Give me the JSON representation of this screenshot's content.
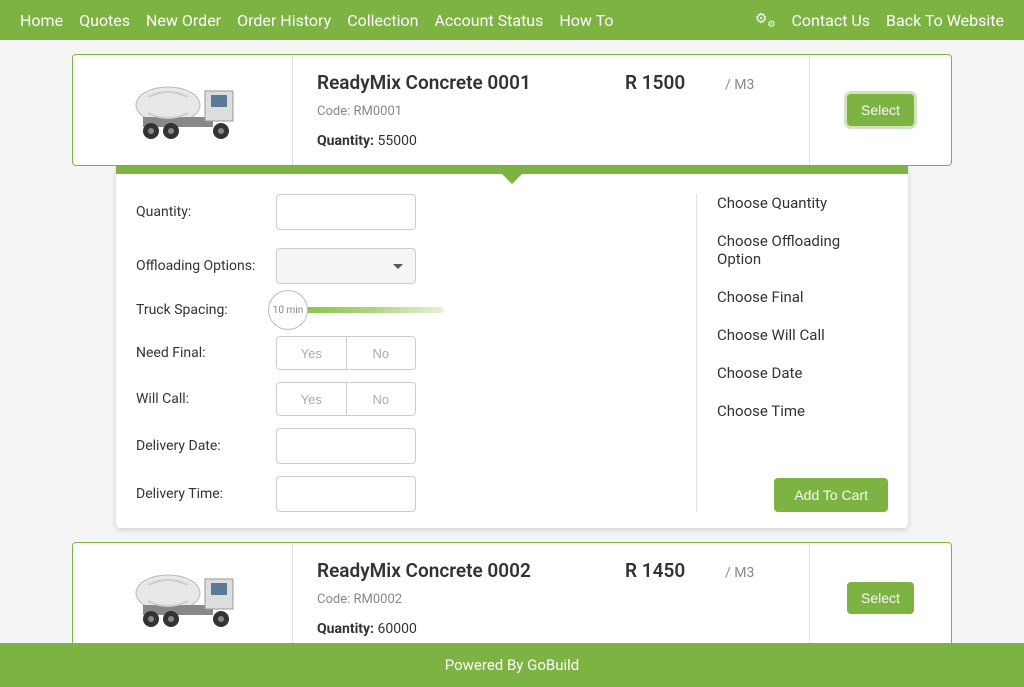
{
  "nav": {
    "left": [
      "Home",
      "Quotes",
      "New Order",
      "Order History",
      "Collection",
      "Account Status",
      "How To"
    ],
    "right": [
      "Contact Us",
      "Back To Website"
    ]
  },
  "products": [
    {
      "title": "ReadyMix Concrete 0001",
      "price": "R 1500",
      "unit": "/ M3",
      "code_label": "Code: ",
      "code": "RM0001",
      "qty_label": "Quantity: ",
      "qty": "55000",
      "select": "Select"
    },
    {
      "title": "ReadyMix Concrete 0002",
      "price": "R 1450",
      "unit": "/ M3",
      "code_label": "Code: ",
      "code": "RM0002",
      "qty_label": "Quantity: ",
      "qty": "60000",
      "select": "Select"
    }
  ],
  "form": {
    "quantity_label": "Quantity:",
    "offloading_label": "Offloading Options:",
    "truck_spacing_label": "Truck Spacing:",
    "truck_spacing_value": "10 min",
    "need_final_label": "Need Final:",
    "will_call_label": "Will Call:",
    "delivery_date_label": "Delivery Date:",
    "delivery_time_label": "Delivery Time:",
    "yes": "Yes",
    "no": "No"
  },
  "steps": [
    "Choose Quantity",
    "Choose Offloading Option",
    "Choose Final",
    "Choose Will Call",
    "Choose Date",
    "Choose Time"
  ],
  "add_to_cart": "Add To Cart",
  "footer": "Powered By GoBuild"
}
